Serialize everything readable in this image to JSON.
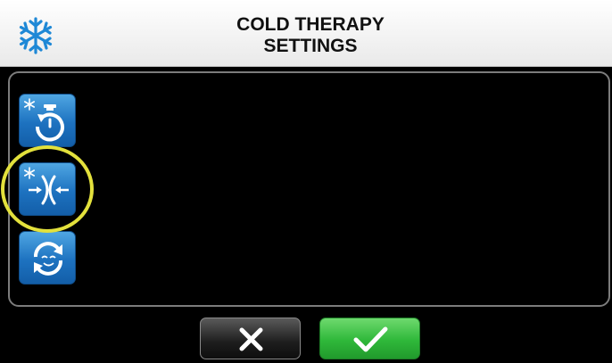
{
  "header": {
    "icon": "snowflake-icon",
    "title_line1": "COLD THERAPY",
    "title_line2": "SETTINGS"
  },
  "modes": [
    {
      "name": "cold-timer-mode",
      "icon": "snowflake-timer-icon"
    },
    {
      "name": "cold-compression-mode",
      "icon": "snowflake-compression-icon",
      "highlighted": true
    },
    {
      "name": "cold-cycle-mode",
      "icon": "cycle-face-icon"
    }
  ],
  "actions": {
    "cancel_icon": "x-icon",
    "confirm_icon": "checkmark-icon"
  },
  "colors": {
    "mode_button": "#1d72c0",
    "highlight_ring": "#e3e13c",
    "confirm": "#2fb83a",
    "cancel": "#1d1d1d",
    "snowflake": "#1e88d6"
  }
}
